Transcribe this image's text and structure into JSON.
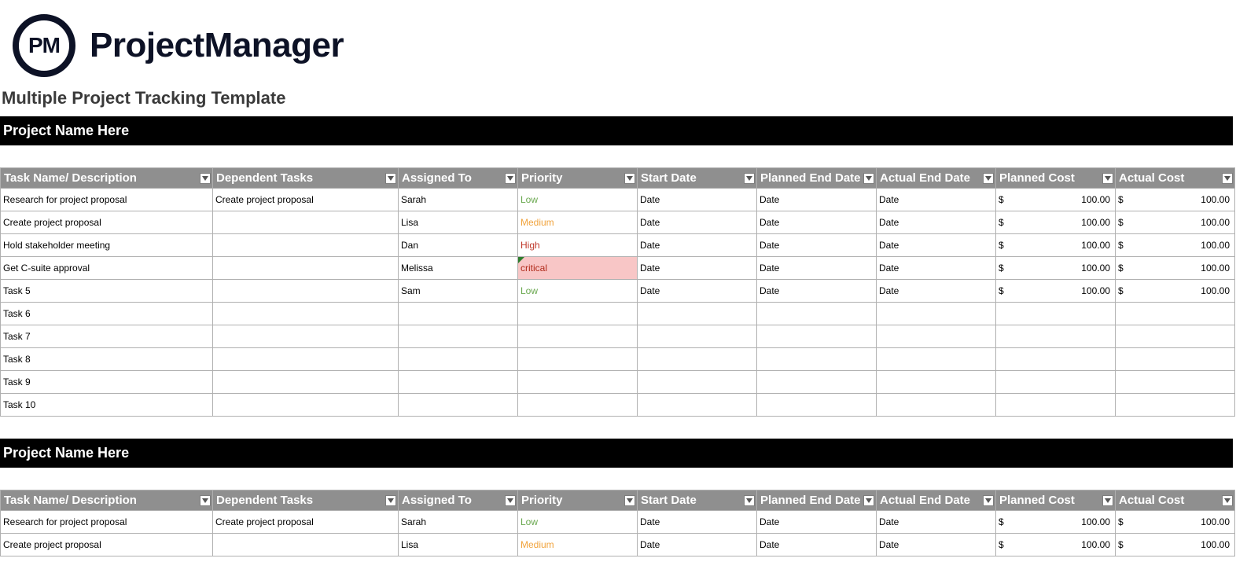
{
  "brand": {
    "logo_text": "PM",
    "name": "ProjectManager"
  },
  "page_title": "Multiple Project Tracking Template",
  "section_label": "Project Name Here",
  "columns": [
    "Task Name/ Description",
    "Dependent Tasks",
    "Assigned To",
    "Priority",
    "Start Date",
    "Planned End Date",
    "Actual End Date",
    "Planned Cost",
    "Actual Cost"
  ],
  "currency_symbol": "$",
  "sections": [
    {
      "rows": [
        {
          "task": "Research for project proposal",
          "dep": "Create project proposal",
          "asg": "Sarah",
          "pri": "Low",
          "pri_cls": "pri-low",
          "sd": "Date",
          "ped": "Date",
          "aed": "Date",
          "pc": "100.00",
          "ac": "100.00"
        },
        {
          "task": "Create project proposal",
          "dep": "",
          "asg": "Lisa",
          "pri": "Medium",
          "pri_cls": "pri-medium",
          "sd": "Date",
          "ped": "Date",
          "aed": "Date",
          "pc": "100.00",
          "ac": "100.00"
        },
        {
          "task": "Hold stakeholder meeting",
          "dep": "",
          "asg": "Dan",
          "pri": "High",
          "pri_cls": "pri-high",
          "sd": "Date",
          "ped": "Date",
          "aed": "Date",
          "pc": "100.00",
          "ac": "100.00"
        },
        {
          "task": "Get C-suite approval",
          "dep": "",
          "asg": "Melissa",
          "pri": "critical",
          "pri_cls": "pri-critical",
          "sd": "Date",
          "ped": "Date",
          "aed": "Date",
          "pc": "100.00",
          "ac": "100.00"
        },
        {
          "task": "Task 5",
          "dep": "",
          "asg": "Sam",
          "pri": "Low",
          "pri_cls": "pri-low",
          "sd": "Date",
          "ped": "Date",
          "aed": "Date",
          "pc": "100.00",
          "ac": "100.00"
        },
        {
          "task": "Task 6",
          "dep": "",
          "asg": "",
          "pri": "",
          "pri_cls": "",
          "sd": "",
          "ped": "",
          "aed": "",
          "pc": "",
          "ac": ""
        },
        {
          "task": "Task 7",
          "dep": "",
          "asg": "",
          "pri": "",
          "pri_cls": "",
          "sd": "",
          "ped": "",
          "aed": "",
          "pc": "",
          "ac": ""
        },
        {
          "task": "Task 8",
          "dep": "",
          "asg": "",
          "pri": "",
          "pri_cls": "",
          "sd": "",
          "ped": "",
          "aed": "",
          "pc": "",
          "ac": ""
        },
        {
          "task": "Task 9",
          "dep": "",
          "asg": "",
          "pri": "",
          "pri_cls": "",
          "sd": "",
          "ped": "",
          "aed": "",
          "pc": "",
          "ac": ""
        },
        {
          "task": "Task 10",
          "dep": "",
          "asg": "",
          "pri": "",
          "pri_cls": "",
          "sd": "",
          "ped": "",
          "aed": "",
          "pc": "",
          "ac": ""
        }
      ]
    },
    {
      "rows": [
        {
          "task": "Research for project proposal",
          "dep": "Create project proposal",
          "asg": "Sarah",
          "pri": "Low",
          "pri_cls": "pri-low",
          "sd": "Date",
          "ped": "Date",
          "aed": "Date",
          "pc": "100.00",
          "ac": "100.00"
        },
        {
          "task": "Create project proposal",
          "dep": "",
          "asg": "Lisa",
          "pri": "Medium",
          "pri_cls": "pri-medium",
          "sd": "Date",
          "ped": "Date",
          "aed": "Date",
          "pc": "100.00",
          "ac": "100.00"
        }
      ]
    }
  ]
}
